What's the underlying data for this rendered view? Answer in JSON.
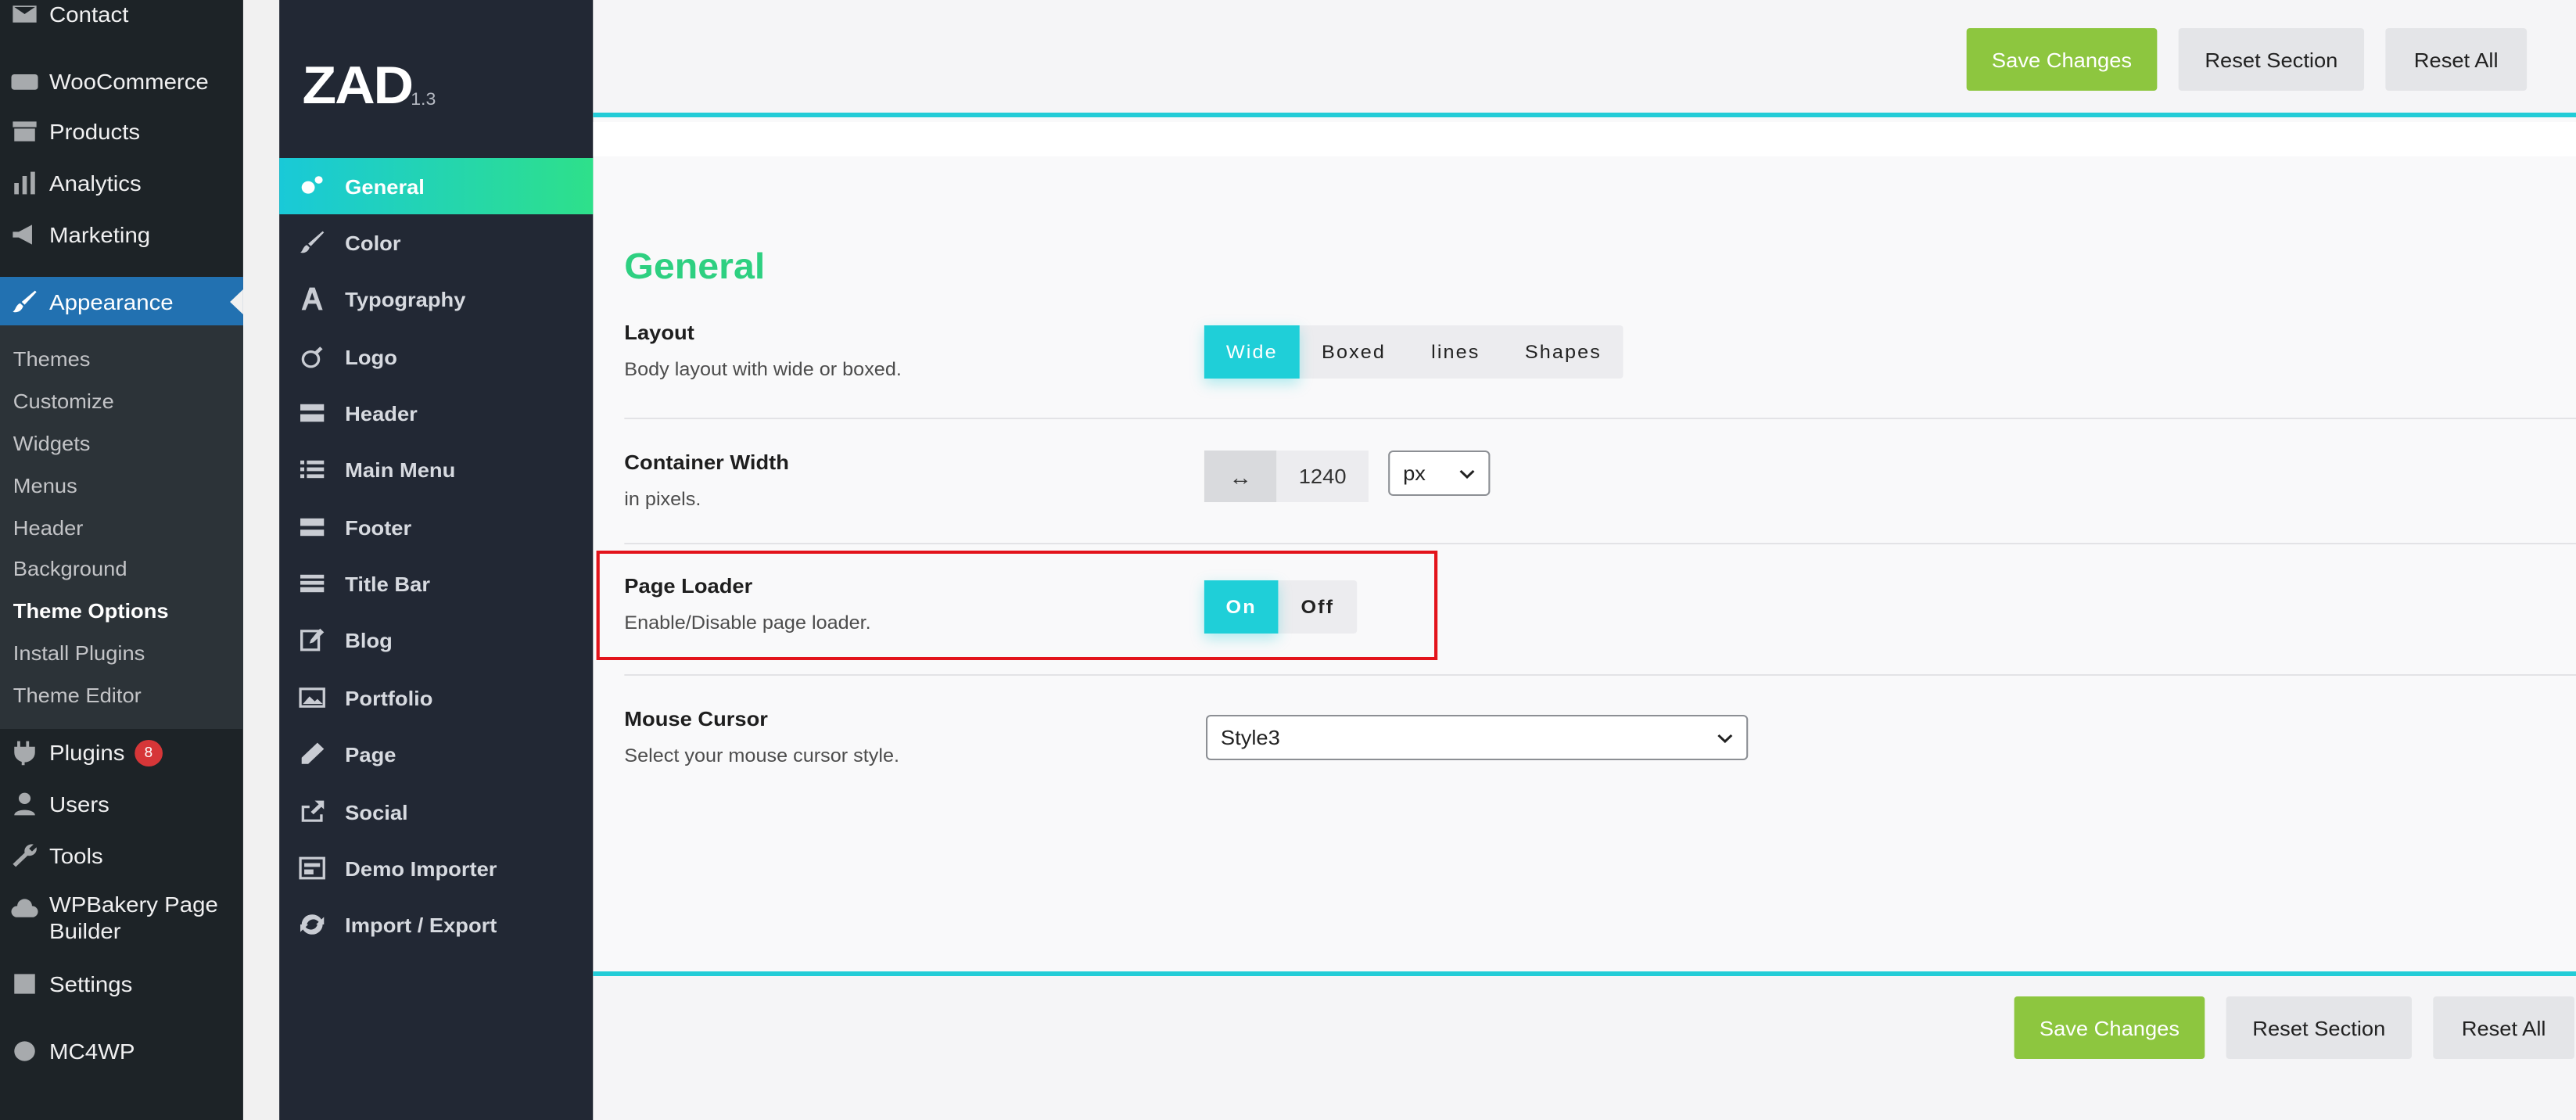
{
  "wp_menu": {
    "contact": "Contact",
    "woocommerce": "WooCommerce",
    "products": "Products",
    "analytics": "Analytics",
    "marketing": "Marketing",
    "appearance": "Appearance",
    "submenu": [
      "Themes",
      "Customize",
      "Widgets",
      "Menus",
      "Header",
      "Background",
      "Theme Options",
      "Install Plugins",
      "Theme Editor"
    ],
    "plugins": "Plugins",
    "plugins_badge": "8",
    "users": "Users",
    "tools": "Tools",
    "wpbakery_line1": "WPBakery Page",
    "wpbakery_line2": "Builder",
    "settings": "Settings",
    "mc4wp": "MC4WP"
  },
  "theme_nav": {
    "logo": "ZAD",
    "version": "1.3",
    "items": [
      "General",
      "Color",
      "Typography",
      "Logo",
      "Header",
      "Main Menu",
      "Footer",
      "Title Bar",
      "Blog",
      "Portfolio",
      "Page",
      "Social",
      "Demo Importer",
      "Import / Export"
    ]
  },
  "actions": {
    "save": "Save Changes",
    "reset_section": "Reset Section",
    "reset_all": "Reset All"
  },
  "section": {
    "title": "General",
    "layout": {
      "label": "Layout",
      "desc": "Body layout with wide or boxed.",
      "options": [
        "Wide",
        "Boxed",
        "lines",
        "Shapes"
      ],
      "selected": "Wide"
    },
    "container_width": {
      "label": "Container Width",
      "desc": "in pixels.",
      "icon": "↔",
      "value": "1240",
      "unit": "px"
    },
    "page_loader": {
      "label": "Page Loader",
      "desc": "Enable/Disable page loader.",
      "on": "On",
      "off": "Off",
      "selected": "On"
    },
    "mouse_cursor": {
      "label": "Mouse Cursor",
      "desc": "Select your mouse cursor style.",
      "value": "Style3"
    }
  },
  "colors": {
    "accent": "#1fcfd8",
    "save_button": "#8dc63f",
    "section_title": "#2ed081",
    "wp_active": "#2271b1",
    "highlight": "#e3141b"
  }
}
